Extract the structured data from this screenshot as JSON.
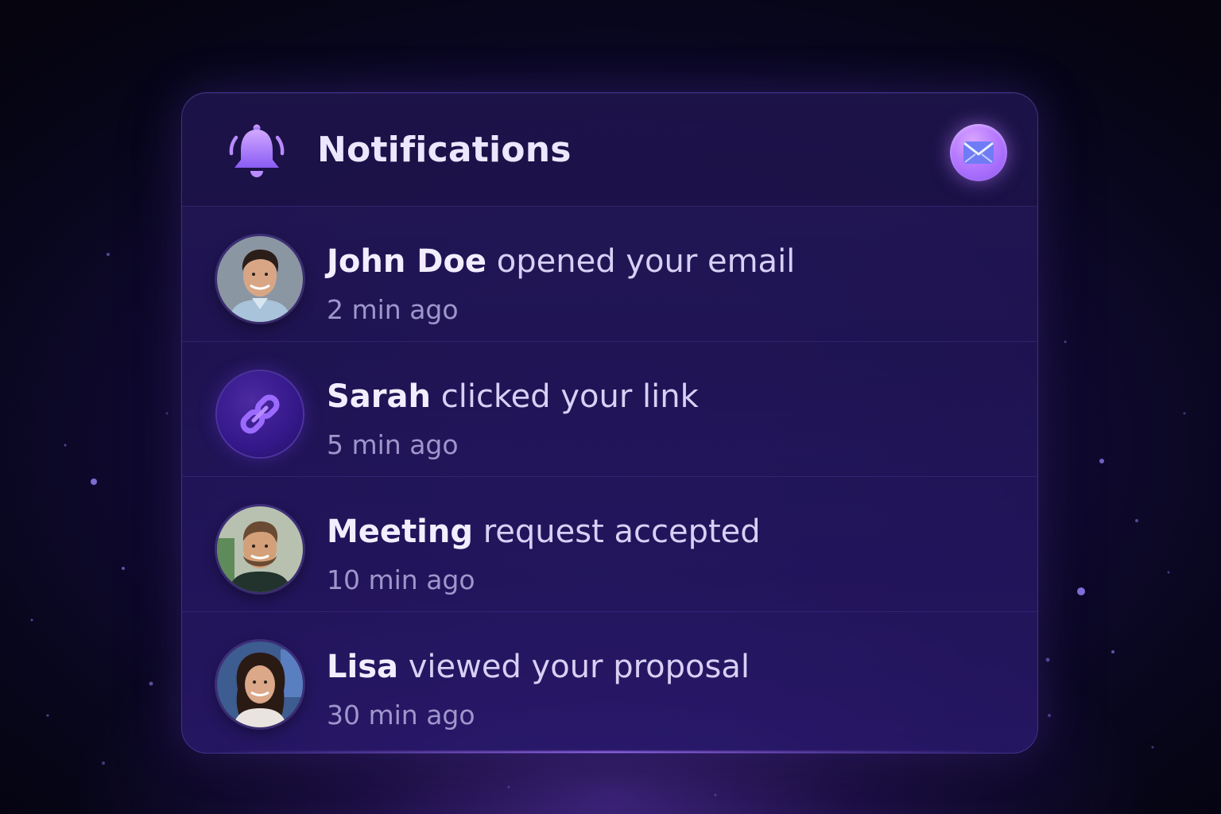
{
  "header": {
    "title": "Notifications",
    "bell_icon": "bell-icon",
    "mail_icon": "mail-icon",
    "mail_button_color": "#b578ff"
  },
  "notifications": [
    {
      "actor": "John Doe",
      "text": "opened your email",
      "time": "2 min ago",
      "avatar": "photo-man-dark-hair"
    },
    {
      "actor": "Sarah",
      "text": "clicked your link",
      "time": "5 min ago",
      "avatar": "link-icon"
    },
    {
      "actor": "Meeting",
      "text": "request accepted",
      "time": "10 min ago",
      "avatar": "photo-man-beard"
    },
    {
      "actor": "Lisa",
      "text": "viewed your proposal",
      "time": "30 min ago",
      "avatar": "photo-woman"
    }
  ],
  "colors": {
    "background": "#120a35",
    "card": "#26185a",
    "accent": "#9b6bff",
    "title_text": "#ece6ff",
    "time_text": "#9f96cc"
  }
}
